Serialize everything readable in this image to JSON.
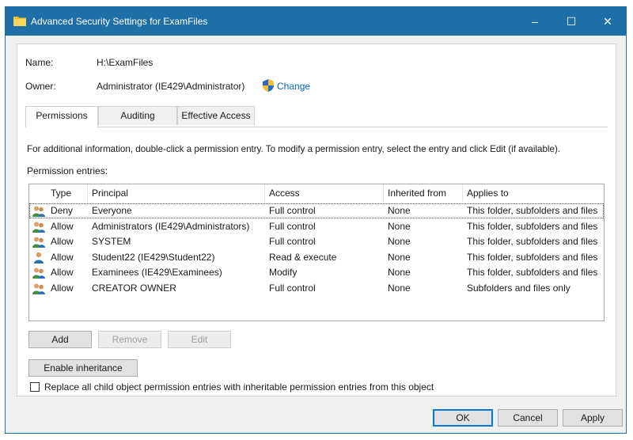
{
  "window": {
    "title": "Advanced Security Settings for ExamFiles"
  },
  "titlebar": {
    "minimize": "–",
    "maximize": "☐",
    "close": "✕"
  },
  "fields": {
    "name_label": "Name:",
    "name_value": "H:\\ExamFiles",
    "owner_label": "Owner:",
    "owner_value": "Administrator (IE429\\Administrator)",
    "change_link": "Change"
  },
  "tabs": [
    "Permissions",
    "Auditing",
    "Effective Access"
  ],
  "info_text": "For additional information, double-click a permission entry. To modify a permission entry, select the entry and click Edit (if available).",
  "entries_label": "Permission entries:",
  "columns": [
    "Type",
    "Principal",
    "Access",
    "Inherited from",
    "Applies to"
  ],
  "rows": [
    {
      "type": "Deny",
      "principal": "Everyone",
      "access": "Full control",
      "inherited": "None",
      "applies": "This folder, subfolders and files",
      "icon": "group-icon"
    },
    {
      "type": "Allow",
      "principal": "Administrators (IE429\\Administrators)",
      "access": "Full control",
      "inherited": "None",
      "applies": "This folder, subfolders and files",
      "icon": "group-icon"
    },
    {
      "type": "Allow",
      "principal": "SYSTEM",
      "access": "Full control",
      "inherited": "None",
      "applies": "This folder, subfolders and files",
      "icon": "group-icon"
    },
    {
      "type": "Allow",
      "principal": "Student22 (IE429\\Student22)",
      "access": "Read & execute",
      "inherited": "None",
      "applies": "This folder, subfolders and files",
      "icon": "user-icon"
    },
    {
      "type": "Allow",
      "principal": "Examinees (IE429\\Examinees)",
      "access": "Modify",
      "inherited": "None",
      "applies": "This folder, subfolders and files",
      "icon": "group-icon"
    },
    {
      "type": "Allow",
      "principal": "CREATOR OWNER",
      "access": "Full control",
      "inherited": "None",
      "applies": "Subfolders and files only",
      "icon": "group-icon"
    }
  ],
  "buttons": {
    "add": "Add",
    "remove": "Remove",
    "edit": "Edit",
    "enable_inheritance": "Enable inheritance",
    "ok": "OK",
    "cancel": "Cancel",
    "apply": "Apply"
  },
  "replace_checkbox": {
    "label": "Replace all child object permission entries with inheritable permission entries from this object",
    "checked": false
  },
  "colors": {
    "titlebar": "#1e6fa8",
    "link": "#0a66c2",
    "default_button_border": "#0078d7"
  }
}
